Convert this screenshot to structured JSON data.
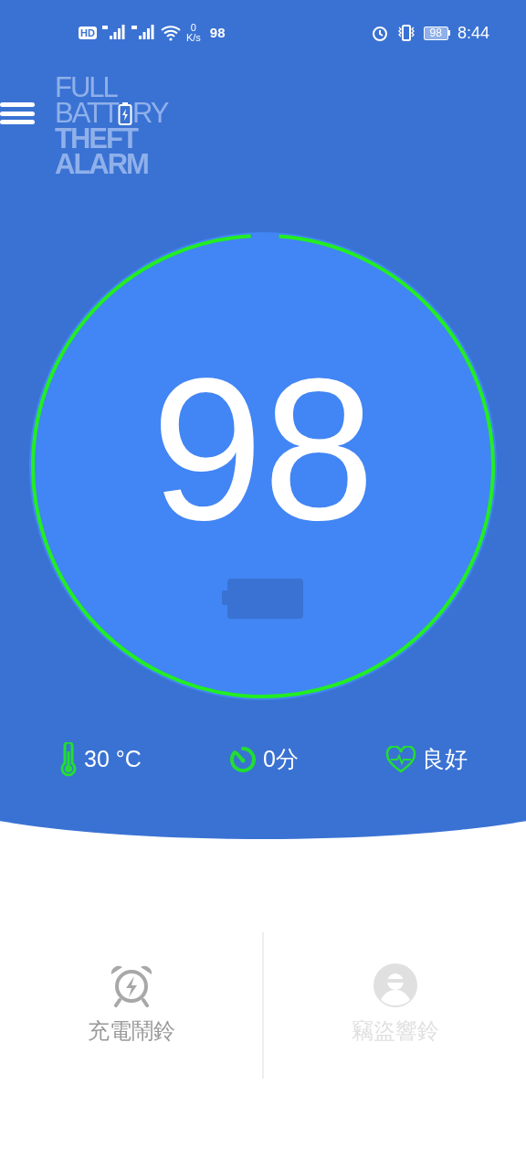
{
  "status_bar": {
    "hd_badge": "HD",
    "net_speed_value": "0",
    "net_speed_unit": "K/s",
    "left_battery": "98",
    "battery": "98",
    "time": "8:44"
  },
  "logo": {
    "line1": "FULL",
    "line2_start": "BATT",
    "line2_end": "RY",
    "line3": "THEFT",
    "line4": "ALARM"
  },
  "gauge": {
    "value": "98",
    "level": 0.98
  },
  "stats": [
    {
      "kind": "temperature",
      "text": "30 °C"
    },
    {
      "kind": "timer",
      "text": "0分"
    },
    {
      "kind": "health",
      "text": "良好"
    }
  ],
  "modes": [
    {
      "kind": "charge",
      "label": "充電鬧鈴",
      "disabled": false
    },
    {
      "kind": "theft",
      "label": "竊盜響鈴",
      "disabled": true
    }
  ]
}
